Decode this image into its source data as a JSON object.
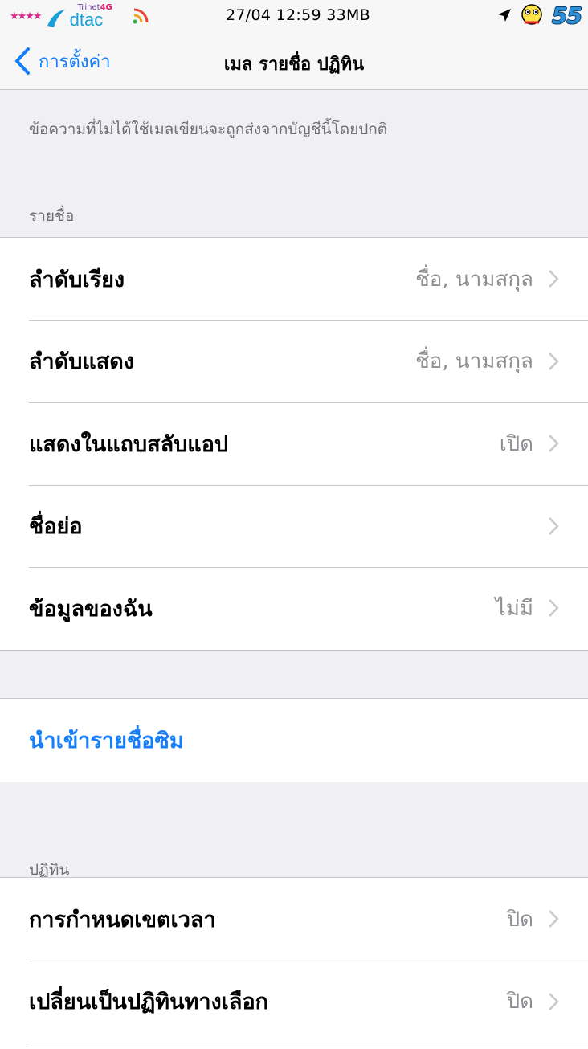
{
  "status_bar": {
    "carrier_network": "Trinet",
    "carrier_badge": "4G",
    "carrier_name": "dtac",
    "time_info": "27/04 12:59 33MB",
    "battery_display": "55"
  },
  "nav": {
    "back_label": "การตั้งค่า",
    "title": "เมล รายชื่อ ปฏิทิน"
  },
  "note": "ข้อความที่ไม่ได้ใช้เมลเขียนจะถูกส่งจากบัญชีนี้โดยปกติ",
  "contacts": {
    "header": "รายชื่อ",
    "rows": [
      {
        "label": "ลำดับเรียง",
        "value": "ชื่อ, นามสกุล"
      },
      {
        "label": "ลำดับแสดง",
        "value": "ชื่อ, นามสกุล"
      },
      {
        "label": "แสดงในแถบสลับแอป",
        "value": "เปิด"
      },
      {
        "label": "ชื่อย่อ",
        "value": ""
      },
      {
        "label": "ข้อมูลของฉัน",
        "value": "ไม่มี"
      }
    ]
  },
  "import_sim": {
    "label": "นำเข้ารายชื่อซิม"
  },
  "calendar": {
    "header": "ปฏิทิน",
    "rows": [
      {
        "label": "การกำหนดเขตเวลา",
        "value": "ปิด"
      },
      {
        "label": "เปลี่ยนเป็นปฏิทินทางเลือก",
        "value": "ปิด"
      }
    ]
  },
  "colors": {
    "accent": "#147efb",
    "background": "#efeff4",
    "secondary_text": "#8e8e93"
  },
  "icons": {
    "back": "chevron-left-icon",
    "disclosure": "chevron-right-icon",
    "location": "location-arrow-icon",
    "wifi": "wifi-icon",
    "signal": "signal-stars-icon"
  }
}
